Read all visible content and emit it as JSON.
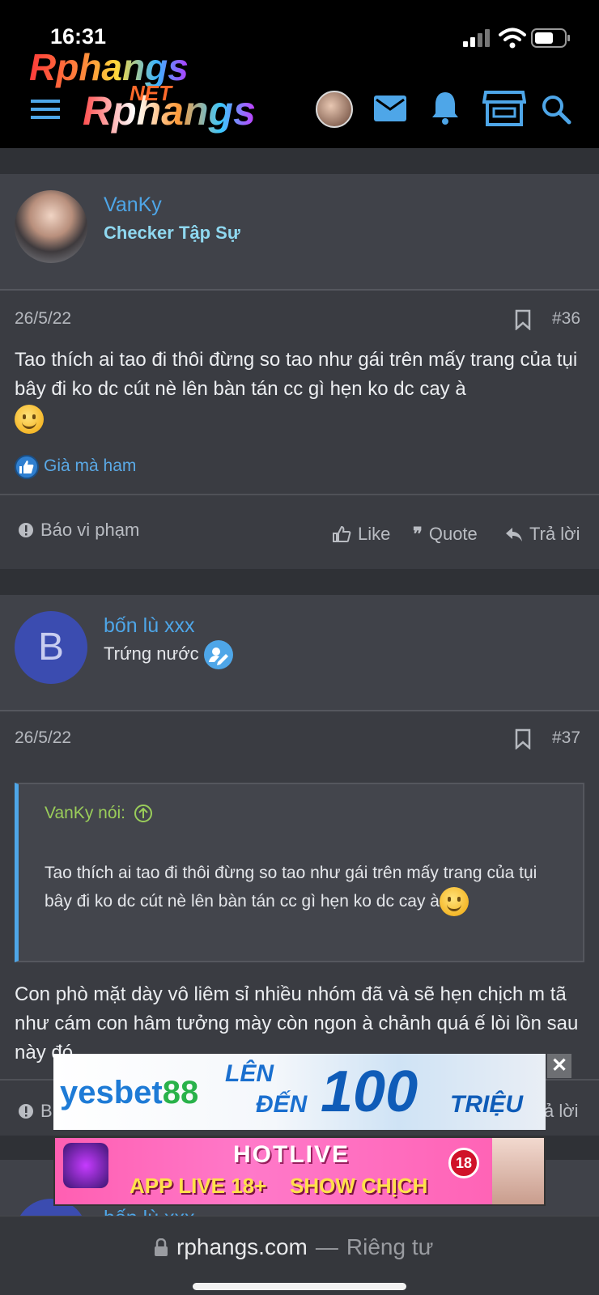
{
  "status_bar": {
    "time": "16:31"
  },
  "header": {
    "logo_top": "Rphangs",
    "logo_main": "Rphangs",
    "logo_net": "NET"
  },
  "posts": [
    {
      "username": "VanKy",
      "user_title": "Checker Tập Sự",
      "date": "26/5/22",
      "post_number": "#36",
      "body": "Tao thích ai tao đi thôi đừng so tao như gái trên mấy trang của tụi bây đi ko dc cút nè lên bàn tán cc gì hẹn ko dc cay à",
      "reaction": "Già mà ham",
      "report_label": "Báo vi phạm",
      "like_label": "Like",
      "quote_label": "Quote",
      "reply_label": "Trả lời"
    },
    {
      "avatar_letter": "B",
      "username": "bốn lù xxx",
      "user_title": "Trứng nước",
      "date": "26/5/22",
      "post_number": "#37",
      "quote_author": "VanKy nói:",
      "quote_text": "Tao thích ai tao đi thôi đừng so tao như gái trên mấy trang của tụi bây đi ko dc cút nè lên bàn tán cc gì hẹn ko dc cay à",
      "body": "Con phò mặt dày vô liêm sỉ nhiều nhóm đã và sẽ hẹn chịch m tã như cám con hâm tưởng mày còn ngon à chảnh quá ế lòi lồn sau này đó",
      "report_label_partial": "B",
      "reply_label_partial": "ả lời"
    },
    {
      "username": "bốn lù xxx"
    }
  ],
  "ads": {
    "yesbet": {
      "brand_a": "yesbet",
      "brand_b": "88",
      "line1": "LÊN",
      "line2": "ĐẾN",
      "big": "100",
      "unit": "TRIỆU",
      "close": "✕"
    },
    "hotlive": {
      "title": "HOTLIVE",
      "left": "APP LIVE 18+",
      "right": "SHOW CHỊCH",
      "badge": "18"
    }
  },
  "bottom_bar": {
    "domain": "rphangs.com",
    "separator": "—",
    "privacy": "Riêng tư"
  },
  "colors": {
    "accent_blue": "#4ea6e8",
    "title_cyan": "#8fd8f0",
    "quote_green": "#9acd5a",
    "bg": "#2b2d31"
  }
}
